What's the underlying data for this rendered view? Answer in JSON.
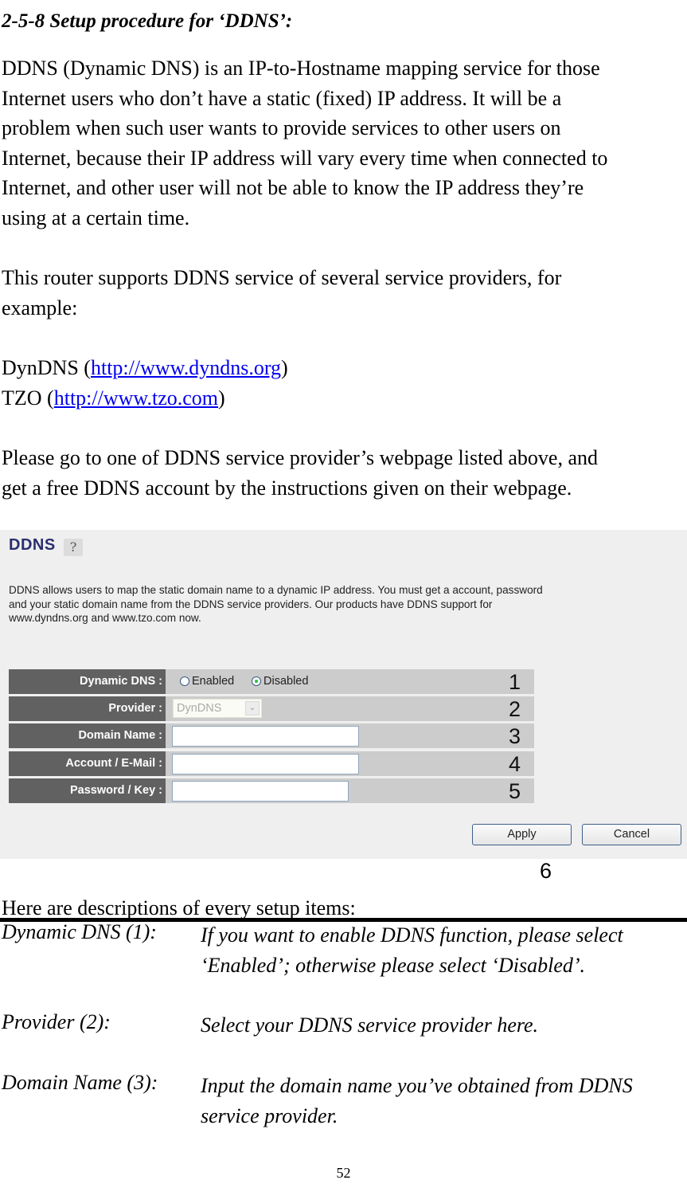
{
  "heading": "2-5-8 Setup procedure for ‘DDNS’:",
  "intro_lines": [
    "DDNS (Dynamic DNS) is an IP-to-Hostname mapping service for those",
    "Internet users who don’t have a static (fixed) IP address. It will be a",
    "problem when such user wants to provide services to other users on",
    "Internet, because their IP address will vary every time when connected to",
    "Internet, and other user will not be able to know the IP address they’re",
    "using at a certain time."
  ],
  "support_lines": [
    "This router supports DDNS service of several service providers, for",
    "example:"
  ],
  "providers": [
    {
      "name": "DynDNS",
      "open": " (",
      "url_text": "http://www.dyndns.org",
      "close": ")"
    },
    {
      "name": "TZO",
      "open": " (",
      "url_text": "http://www.tzo.com",
      "close": ")"
    }
  ],
  "instruction_lines": [
    "Please go to one of DDNS service provider’s webpage listed above, and",
    "get a free DDNS account by the instructions given on their webpage."
  ],
  "panel": {
    "title": "DDNS",
    "help_icon": "help-icon",
    "description_lines": [
      "DDNS allows users to map the static domain name to a dynamic IP address. You must get a account, password",
      "and your static domain name from the DDNS service providers. Our products have DDNS support for",
      "www.dyndns.org and www.tzo.com now."
    ],
    "rows": [
      {
        "label": "Dynamic DNS :",
        "callout": "1"
      },
      {
        "label": "Provider :",
        "callout": "2"
      },
      {
        "label": "Domain Name :",
        "callout": "3"
      },
      {
        "label": "Account / E-Mail :",
        "callout": "4"
      },
      {
        "label": "Password / Key :",
        "callout": "5"
      }
    ],
    "dynamic_dns": {
      "options": [
        "Enabled",
        "Disabled"
      ],
      "selected": "Disabled"
    },
    "provider_select": {
      "value": "DynDNS"
    },
    "domain_name": {
      "value": ""
    },
    "account_email": {
      "value": ""
    },
    "password_key": {
      "value": ""
    },
    "apply_label": "Apply",
    "cancel_label": "Cancel",
    "buttons_callout": "6",
    "colors": {
      "label_bg": "#616161",
      "row_bg": "#cccccc",
      "panel_bg": "#efefef",
      "title_color": "#2a2f6e",
      "radio_selected": "#2fbf3f"
    }
  },
  "descriptions_intro": "Here are descriptions of every setup items:",
  "descriptions": [
    {
      "term": "Dynamic DNS (1):",
      "lines": [
        "If you want to enable DDNS function, please select",
        "‘Enabled’; otherwise please select ‘Disabled’."
      ]
    },
    {
      "term": "Provider (2):",
      "lines": [
        "Select your DDNS service provider here."
      ]
    },
    {
      "term": "Domain Name (3):",
      "lines": [
        "Input the domain name you’ve obtained from DDNS",
        "service provider."
      ]
    }
  ],
  "page_number": "52"
}
